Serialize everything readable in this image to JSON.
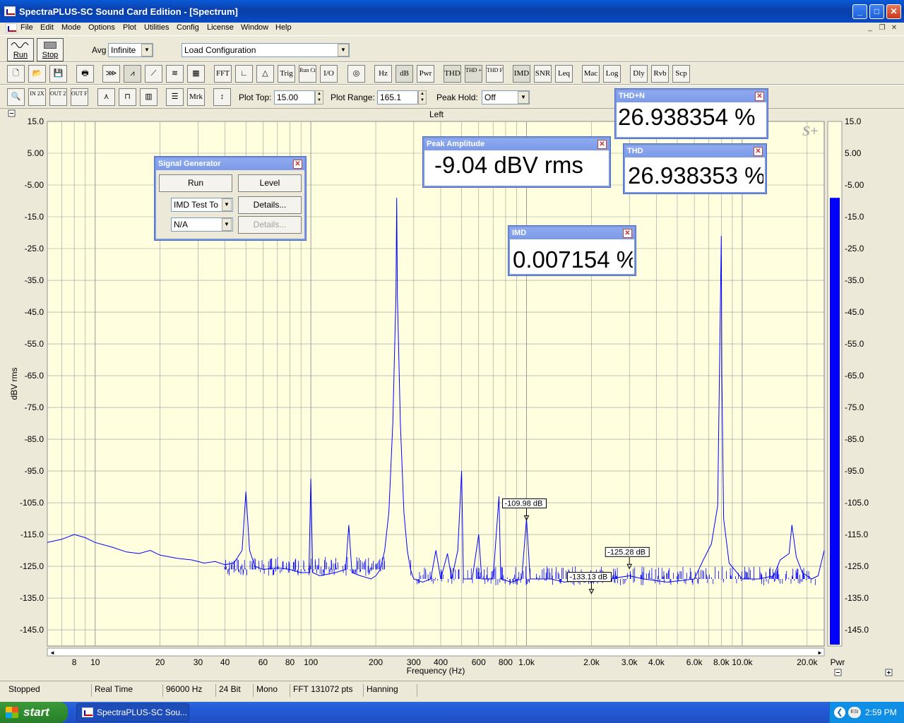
{
  "window": {
    "title": "SpectraPLUS-SC Sound Card Edition - [Spectrum]"
  },
  "menu": [
    "File",
    "Edit",
    "Mode",
    "Options",
    "Plot",
    "Utilities",
    "Config",
    "License",
    "Window",
    "Help"
  ],
  "toolbar1": {
    "run_label": "Run",
    "stop_label": "Stop",
    "avg_label": "Avg",
    "avg_value": "Infinite",
    "load_config_value": "Load Configuration"
  },
  "toolbar2": {
    "buttons": [
      "FFT",
      "Trig",
      "Run Ctrl",
      "I/O",
      "Hz",
      "dB",
      "Pwr",
      "THD",
      "THD +N",
      "THD Freq",
      "IMD",
      "SNR",
      "Leq",
      "Mac",
      "Log",
      "Dly",
      "Rvb",
      "Scp"
    ]
  },
  "toolbar3": {
    "zoom_labels": [
      "IN 2X",
      "OUT 2X",
      "OUT FULL"
    ],
    "mrk_label": "Mrk",
    "plot_top_label": "Plot Top:",
    "plot_top_value": "15.00",
    "plot_range_label": "Plot Range:",
    "plot_range_value": "165.1",
    "peak_hold_label": "Peak Hold:",
    "peak_hold_value": "Off"
  },
  "plot": {
    "channel_title": "Left",
    "logo": "S+",
    "pwr_label": "Pwr",
    "markers": [
      {
        "label": "-109.98 dB",
        "freq": 1000,
        "db": -109.98
      },
      {
        "label": "-125.28 dB",
        "freq": 3000,
        "db": -125.28
      },
      {
        "label": "-133.13 dB",
        "freq": 2000,
        "db": -133.13
      }
    ]
  },
  "chart_data": {
    "type": "line",
    "xlabel": "Frequency (Hz)",
    "ylabel": "dBV rms",
    "xscale": "log",
    "xlim": [
      6,
      24000
    ],
    "ylim": [
      -150.1,
      15
    ],
    "y_ticks": [
      "15.0",
      "5.00",
      "-5.00",
      "-15.0",
      "-25.0",
      "-35.0",
      "-45.0",
      "-55.0",
      "-65.0",
      "-75.0",
      "-85.0",
      "-95.0",
      "-105.0",
      "-115.0",
      "-125.0",
      "-135.0",
      "-145.0"
    ],
    "y_tick_values": [
      15,
      5,
      -5,
      -15,
      -25,
      -35,
      -45,
      -55,
      -65,
      -75,
      -85,
      -95,
      -105,
      -115,
      -125,
      -135,
      -145
    ],
    "x_ticks": [
      {
        "v": 8,
        "t": "8"
      },
      {
        "v": 10,
        "t": "10"
      },
      {
        "v": 20,
        "t": "20"
      },
      {
        "v": 30,
        "t": "30"
      },
      {
        "v": 40,
        "t": "40"
      },
      {
        "v": 60,
        "t": "60"
      },
      {
        "v": 80,
        "t": "80"
      },
      {
        "v": 100,
        "t": "100"
      },
      {
        "v": 200,
        "t": "200"
      },
      {
        "v": 300,
        "t": "300"
      },
      {
        "v": 400,
        "t": "400"
      },
      {
        "v": 600,
        "t": "600"
      },
      {
        "v": 800,
        "t": "800"
      },
      {
        "v": 1000,
        "t": "1.0k"
      },
      {
        "v": 2000,
        "t": "2.0k"
      },
      {
        "v": 3000,
        "t": "3.0k"
      },
      {
        "v": 4000,
        "t": "4.0k"
      },
      {
        "v": 6000,
        "t": "6.0k"
      },
      {
        "v": 8000,
        "t": "8.0k"
      },
      {
        "v": 10000,
        "t": "10.0k"
      },
      {
        "v": 20000,
        "t": "20.0k"
      }
    ],
    "series": [
      {
        "points": [
          [
            6,
            -117.5
          ],
          [
            7,
            -116.5
          ],
          [
            8,
            -115
          ],
          [
            9,
            -116
          ],
          [
            10,
            -117.5
          ],
          [
            12,
            -119
          ],
          [
            14,
            -120.5
          ],
          [
            16,
            -121
          ],
          [
            18,
            -120
          ],
          [
            20,
            -121.5
          ],
          [
            24,
            -122.5
          ],
          [
            28,
            -123
          ],
          [
            32,
            -124
          ],
          [
            36,
            -123.5
          ],
          [
            40,
            -124.5
          ],
          [
            44,
            -124
          ],
          [
            48,
            -120
          ],
          [
            50,
            -101.5
          ],
          [
            52,
            -120
          ],
          [
            55,
            -125
          ],
          [
            60,
            -126
          ],
          [
            70,
            -125.5
          ],
          [
            80,
            -126
          ],
          [
            90,
            -127
          ],
          [
            98,
            -127
          ],
          [
            100,
            -97.5
          ],
          [
            102,
            -127
          ],
          [
            110,
            -128
          ],
          [
            130,
            -127
          ],
          [
            145,
            -126
          ],
          [
            150,
            -112
          ],
          [
            155,
            -127
          ],
          [
            170,
            -128
          ],
          [
            190,
            -129
          ],
          [
            200,
            -128
          ],
          [
            210,
            -126
          ],
          [
            220,
            -120
          ],
          [
            230,
            -108
          ],
          [
            240,
            -80
          ],
          [
            248,
            -40
          ],
          [
            250,
            -9
          ],
          [
            252,
            -40
          ],
          [
            260,
            -80
          ],
          [
            270,
            -108
          ],
          [
            280,
            -120
          ],
          [
            290,
            -126
          ],
          [
            300,
            -129
          ],
          [
            330,
            -130
          ],
          [
            360,
            -129
          ],
          [
            380,
            -120
          ],
          [
            400,
            -129
          ],
          [
            430,
            -121
          ],
          [
            450,
            -129
          ],
          [
            480,
            -120
          ],
          [
            500,
            -95
          ],
          [
            510,
            -129
          ],
          [
            560,
            -129
          ],
          [
            600,
            -115
          ],
          [
            620,
            -129
          ],
          [
            700,
            -129
          ],
          [
            745,
            -103
          ],
          [
            760,
            -129
          ],
          [
            850,
            -130
          ],
          [
            950,
            -129
          ],
          [
            1000,
            -110
          ],
          [
            1040,
            -129
          ],
          [
            1300,
            -129
          ],
          [
            1500,
            -130
          ],
          [
            1800,
            -129
          ],
          [
            2000,
            -130
          ],
          [
            2400,
            -129
          ],
          [
            3000,
            -128
          ],
          [
            3500,
            -129
          ],
          [
            4500,
            -130
          ],
          [
            6000,
            -129
          ],
          [
            6600,
            -123
          ],
          [
            7200,
            -118
          ],
          [
            7700,
            -106
          ],
          [
            8000,
            -21
          ],
          [
            8050,
            -65
          ],
          [
            8200,
            -110
          ],
          [
            8700,
            -124
          ],
          [
            10000,
            -129
          ],
          [
            12000,
            -129
          ],
          [
            14000,
            -128
          ],
          [
            15000,
            -123
          ],
          [
            16500,
            -121
          ],
          [
            17000,
            -112
          ],
          [
            17800,
            -122
          ],
          [
            19000,
            -127
          ],
          [
            21000,
            -129
          ],
          [
            22500,
            -128
          ],
          [
            24000,
            -120
          ]
        ]
      }
    ],
    "pwr_bar": {
      "value": -9.04,
      "top": 15,
      "bottom": -150.1,
      "color": "#0000ff"
    }
  },
  "signal_generator": {
    "title": "Signal Generator",
    "run": "Run",
    "level": "Level",
    "signal_value": "IMD Test To",
    "details1": "Details...",
    "n_a": "N/A",
    "details2": "Details..."
  },
  "readouts": {
    "thdn": {
      "title": "THD+N",
      "value": "26.938354 %"
    },
    "thd": {
      "title": "THD",
      "value": "26.938353 %"
    },
    "peak": {
      "title": "Peak Amplitude",
      "value": "-9.04 dBV rms"
    },
    "imd": {
      "title": "IMD",
      "value": "0.007154 %"
    }
  },
  "status": [
    "Stopped",
    "Real Time",
    "96000 Hz",
    "24 Bit",
    "Mono",
    "FFT 131072 pts",
    "Hanning"
  ],
  "taskbar": {
    "start": "start",
    "item": "SpectraPLUS-SC Sou...",
    "time": "2:59 PM"
  },
  "colors": {
    "plot_bg": "#ffffe0",
    "trace": "#0000ff",
    "titlebar": "#0a4fd0"
  }
}
